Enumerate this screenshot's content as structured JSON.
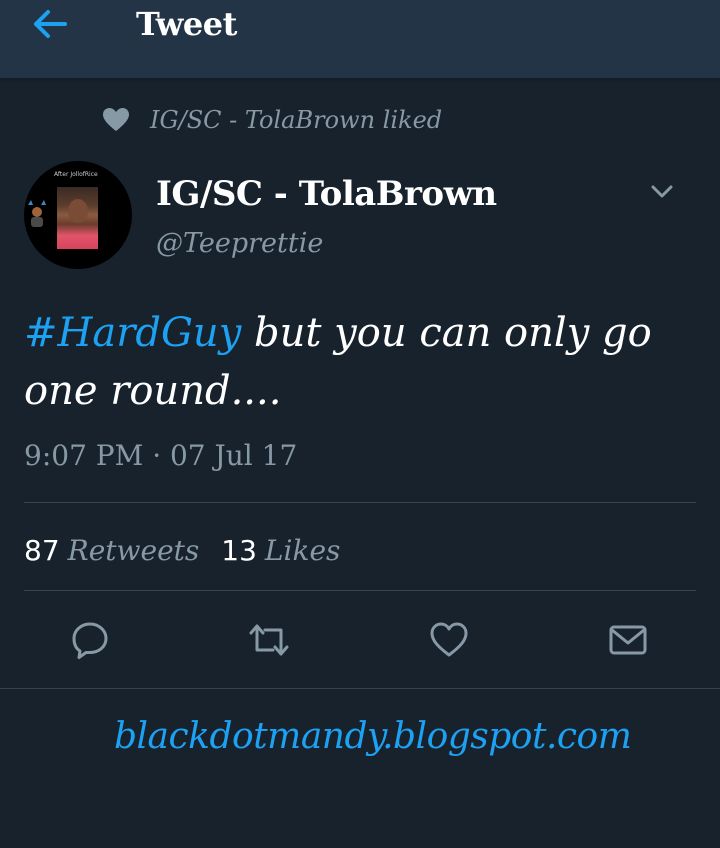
{
  "header": {
    "title": "Tweet",
    "back_icon": "arrow-left-icon"
  },
  "social_context": {
    "text": "IG/SC - TolaBrown liked",
    "icon": "heart-icon"
  },
  "author": {
    "display_name": "IG/SC - TolaBrown",
    "handle": "@Teeprettie",
    "avatar_caption": "After JollofRice"
  },
  "tweet": {
    "hashtag": "#HardGuy",
    "text_rest": " but you can only go one round....",
    "timestamp": "9:07 PM · 07 Jul 17"
  },
  "stats": {
    "retweets_count": "87",
    "retweets_label": "Retweets",
    "likes_count": "13",
    "likes_label": "Likes"
  },
  "actions": {
    "reply_icon": "reply-icon",
    "retweet_icon": "retweet-icon",
    "like_icon": "heart-icon",
    "dm_icon": "envelope-icon"
  },
  "watermark": {
    "text": "blackdotmandy.blogspot.com"
  },
  "colors": {
    "background": "#18222d",
    "header": "#243447",
    "accent": "#1da1f2",
    "muted": "#8899a6",
    "divider": "#38444d"
  }
}
